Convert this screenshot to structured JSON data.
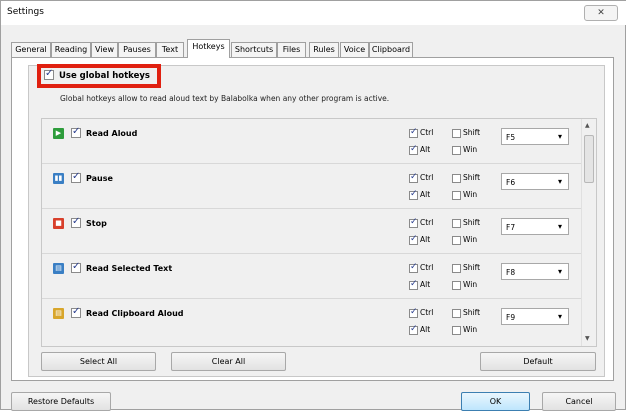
{
  "window": {
    "title": "Settings",
    "close_glyph": "✕"
  },
  "tabs": [
    {
      "label": "General"
    },
    {
      "label": "Reading"
    },
    {
      "label": "View"
    },
    {
      "label": "Pauses"
    },
    {
      "label": "Text"
    },
    {
      "label": "Hotkeys",
      "active": true
    },
    {
      "label": "Shortcuts"
    },
    {
      "label": "Files"
    },
    {
      "label": "Rules"
    },
    {
      "label": "Voice"
    },
    {
      "label": "Clipboard"
    }
  ],
  "global": {
    "label": "Use global hotkeys",
    "checked": true,
    "description": "Global hotkeys allow to read aloud text by Balabolka when any other program is active."
  },
  "modifiers": {
    "ctrl": "Ctrl",
    "alt": "Alt",
    "shift": "Shift",
    "win": "Win"
  },
  "hotkeys": [
    {
      "label": "Read Aloud",
      "icon": "play-icon",
      "key": "F5",
      "ctrl": true,
      "alt": true,
      "shift": false,
      "win": false
    },
    {
      "label": "Pause",
      "icon": "pause-icon",
      "key": "F6",
      "ctrl": true,
      "alt": true,
      "shift": false,
      "win": false
    },
    {
      "label": "Stop",
      "icon": "stop-icon",
      "key": "F7",
      "ctrl": true,
      "alt": true,
      "shift": false,
      "win": false
    },
    {
      "label": "Read Selected Text",
      "icon": "read-selected-icon",
      "key": "F8",
      "ctrl": true,
      "alt": true,
      "shift": false,
      "win": false
    },
    {
      "label": "Read Clipboard Aloud",
      "icon": "read-clipboard-icon",
      "key": "F9",
      "ctrl": true,
      "alt": true,
      "shift": false,
      "win": false
    }
  ],
  "buttons": {
    "select_all": "Select All",
    "clear_all": "Clear All",
    "default": "Default",
    "restore_defaults": "Restore Defaults",
    "ok": "OK",
    "cancel": "Cancel"
  },
  "colors": {
    "highlight_border": "#e02010",
    "play_icon": "#2e9d3c",
    "pause_icon": "#3a7fc4",
    "stop_icon": "#d8402c",
    "selected_icon": "#3a7fc4",
    "clipboard_icon": "#d8a62c"
  }
}
